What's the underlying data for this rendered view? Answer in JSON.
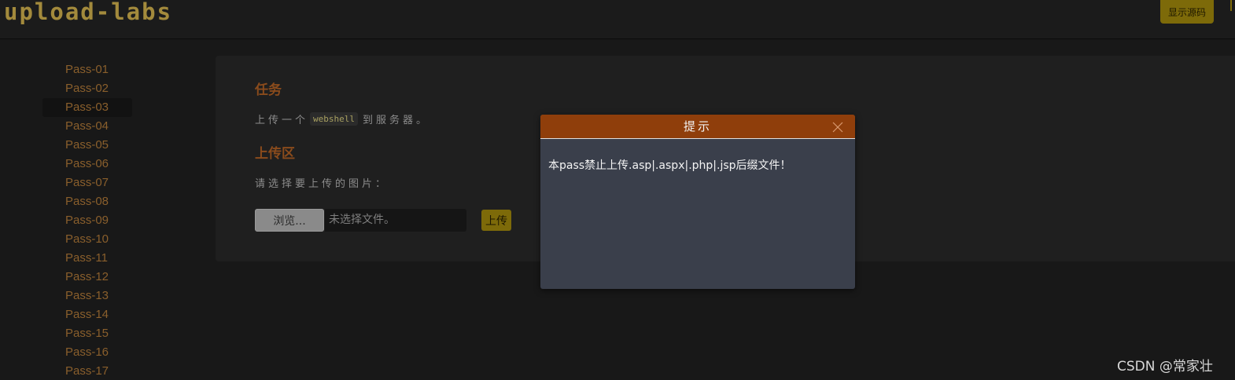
{
  "header": {
    "logo_text": "upload-labs",
    "show_source_label": "显示源码"
  },
  "sidebar": {
    "active": "Pass-03",
    "items": [
      {
        "label": "Pass-01"
      },
      {
        "label": "Pass-02"
      },
      {
        "label": "Pass-03"
      },
      {
        "label": "Pass-04"
      },
      {
        "label": "Pass-05"
      },
      {
        "label": "Pass-06"
      },
      {
        "label": "Pass-07"
      },
      {
        "label": "Pass-08"
      },
      {
        "label": "Pass-09"
      },
      {
        "label": "Pass-10"
      },
      {
        "label": "Pass-11"
      },
      {
        "label": "Pass-12"
      },
      {
        "label": "Pass-13"
      },
      {
        "label": "Pass-14"
      },
      {
        "label": "Pass-15"
      },
      {
        "label": "Pass-16"
      },
      {
        "label": "Pass-17"
      }
    ]
  },
  "main": {
    "task_heading": "任务",
    "task_prefix": "上传一个",
    "task_code": "webshell",
    "task_suffix": "到服务器。",
    "upload_heading": "上传区",
    "choose_label": "请选择要上传的图片：",
    "browse_label": "浏览...",
    "file_status": "未选择文件。",
    "upload_label": "上传"
  },
  "dialog": {
    "title": "提示",
    "message": "本pass禁止上传.asp|.aspx|.php|.jsp后缀文件！"
  },
  "watermark": "CSDN @常家壮",
  "colors": {
    "accent_gold": "#7d6a09",
    "link_orange": "#8a5f2c",
    "dialog_header": "#8f3e0b",
    "dialog_body": "#3a3f4b"
  }
}
